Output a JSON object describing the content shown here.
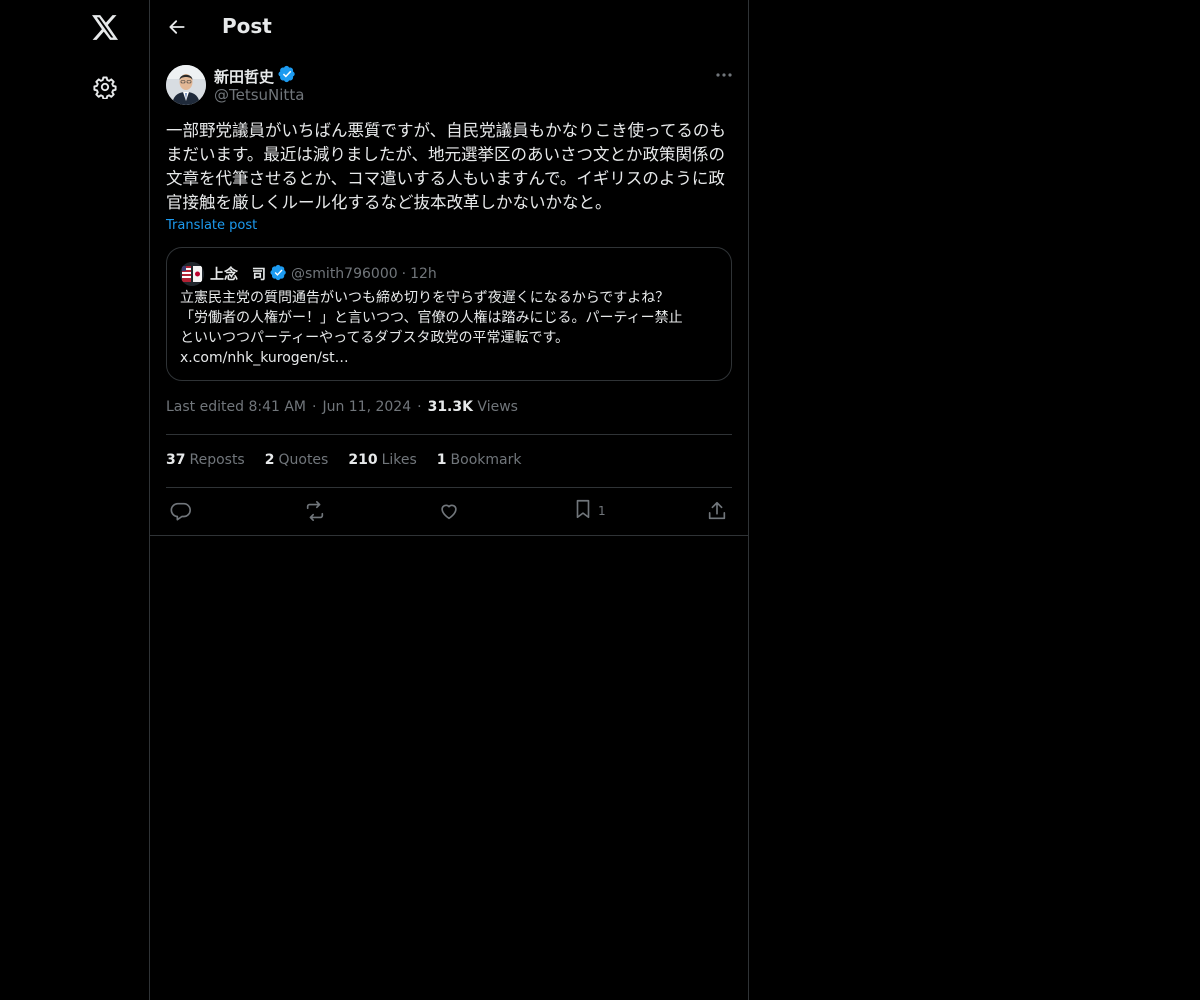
{
  "nav": {
    "logo_icon": "x-logo-icon",
    "settings_icon": "gear-icon"
  },
  "header": {
    "title": "Post",
    "back_icon": "arrow-left-icon"
  },
  "post": {
    "author_name": "新田哲史",
    "author_handle": "@TetsuNitta",
    "verified": true,
    "text": "一部野党議員がいちばん悪質ですが、自民党議員もかなりこき使ってるのもまだいます。最近は減りましたが、地元選挙区のあいさつ文とか政策関係の文章を代筆させるとか、コマ遣いする人もいますんで。イギリスのように政官接触を厳しくルール化するなど抜本改革しかないかなと。",
    "translate_label": "Translate post",
    "edited_label": "Last edited 8:41 AM",
    "date": "Jun 11, 2024",
    "separator": "·",
    "views_count": "31.3K",
    "views_label": "Views"
  },
  "quote": {
    "author_name": "上念　司",
    "author_handle": "@smith796000",
    "separator": "·",
    "time": "12h",
    "text_lines": [
      "立憲民主党の質問通告がいつも締め切りを守らず夜遅くになるからですよね？",
      "「労働者の人権がー！」と言いつつ、官僚の人権は踏みにじる。パーティー禁止",
      "といいつつパーティーやってるダブスタ政党の平常運転です。",
      "x.com/nhk_kurogen/st…"
    ]
  },
  "stats": [
    {
      "num": "37",
      "label": "Reposts"
    },
    {
      "num": "2",
      "label": "Quotes"
    },
    {
      "num": "210",
      "label": "Likes"
    },
    {
      "num": "1",
      "label": "Bookmark"
    }
  ],
  "actions": {
    "reply_icon": "reply-icon",
    "repost_icon": "repost-icon",
    "like_icon": "heart-icon",
    "bookmark_icon": "bookmark-icon",
    "bookmark_count": "1",
    "share_icon": "share-icon"
  },
  "colors": {
    "background": "#000000",
    "accent": "#1d9bf0",
    "muted": "#71767b",
    "border": "#2f3336",
    "text": "#e7e9ea"
  }
}
